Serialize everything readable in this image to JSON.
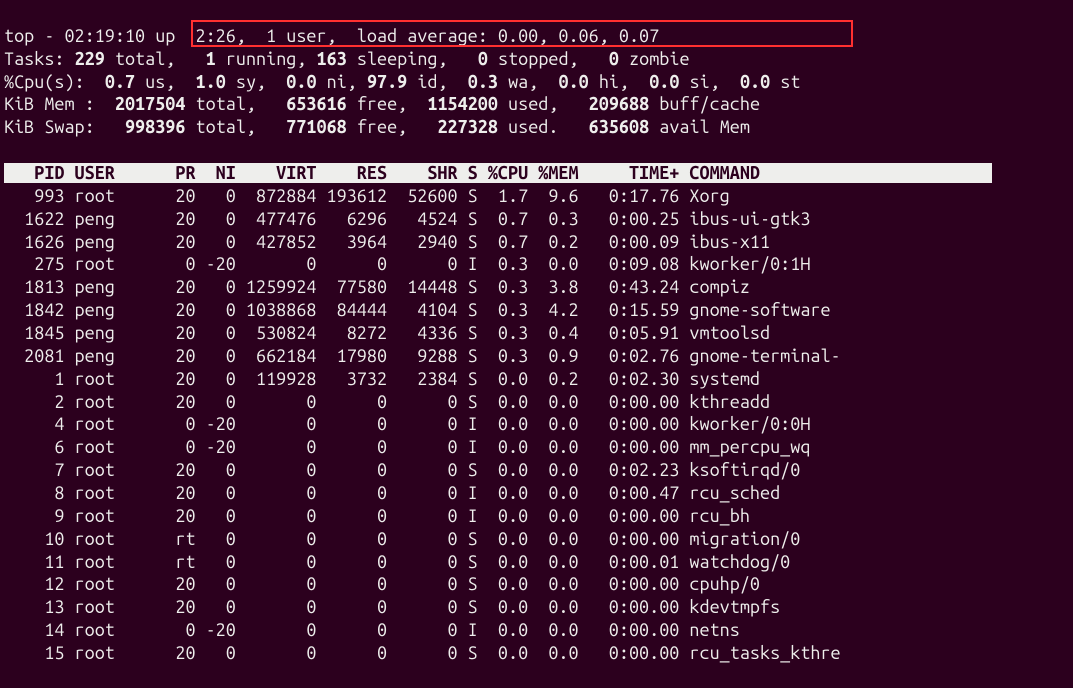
{
  "summary": {
    "l1a": "top - 02:19:10 up  2:26,  1 user,  load average: 0.00, 0.06, 0.07",
    "l1b": "",
    "l2a": "Tasks: ",
    "l2b": "229 ",
    "l2c": "total,   ",
    "l2d": "1 ",
    "l2e": "running, ",
    "l2f": "163 ",
    "l2g": "sleeping,   ",
    "l2h": "0 ",
    "l2i": "stopped,   ",
    "l2j": "0 ",
    "l2k": "zombie",
    "l3a": "%Cpu(s):  ",
    "l3b": "0.7 ",
    "l3c": "us,  ",
    "l3d": "1.0 ",
    "l3e": "sy,  ",
    "l3f": "0.0 ",
    "l3g": "ni, ",
    "l3h": "97.9 ",
    "l3i": "id,  ",
    "l3j": "0.3 ",
    "l3k": "wa,  ",
    "l3l": "0.0 ",
    "l3m": "hi,  ",
    "l3n": "0.0 ",
    "l3o": "si,  ",
    "l3p": "0.0 ",
    "l3q": "st",
    "l4a": "KiB Mem :  ",
    "l4b": "2017504 ",
    "l4c": "total,   ",
    "l4d": "653616 ",
    "l4e": "free,  ",
    "l4f": "1154200 ",
    "l4g": "used,   ",
    "l4h": "209688 ",
    "l4i": "buff/cache",
    "l5a": "KiB Swap:   ",
    "l5b": "998396 ",
    "l5c": "total,   ",
    "l5d": "771068 ",
    "l5e": "free,   ",
    "l5f": "227328 ",
    "l5g": "used.   ",
    "l5h": "635608 ",
    "l5i": "avail Mem "
  },
  "columns": [
    "PID",
    "USER",
    "PR",
    "NI",
    "VIRT",
    "RES",
    "SHR",
    "S",
    "%CPU",
    "%MEM",
    "TIME+",
    "COMMAND"
  ],
  "header": "   PID USER      PR  NI    VIRT    RES    SHR S %CPU %MEM     TIME+ COMMAND                       ",
  "processes": [
    {
      "pid": 993,
      "user": "root",
      "pr": "20",
      "ni": "0",
      "virt": "872884",
      "res": "193612",
      "shr": "52600",
      "s": "S",
      "cpu": "1.7",
      "mem": "9.6",
      "time": "0:17.76",
      "command": "Xorg"
    },
    {
      "pid": 1622,
      "user": "peng",
      "pr": "20",
      "ni": "0",
      "virt": "477476",
      "res": "6296",
      "shr": "4524",
      "s": "S",
      "cpu": "0.7",
      "mem": "0.3",
      "time": "0:00.25",
      "command": "ibus-ui-gtk3"
    },
    {
      "pid": 1626,
      "user": "peng",
      "pr": "20",
      "ni": "0",
      "virt": "427852",
      "res": "3964",
      "shr": "2940",
      "s": "S",
      "cpu": "0.7",
      "mem": "0.2",
      "time": "0:00.09",
      "command": "ibus-x11"
    },
    {
      "pid": 275,
      "user": "root",
      "pr": "0",
      "ni": "-20",
      "virt": "0",
      "res": "0",
      "shr": "0",
      "s": "I",
      "cpu": "0.3",
      "mem": "0.0",
      "time": "0:09.08",
      "command": "kworker/0:1H"
    },
    {
      "pid": 1813,
      "user": "peng",
      "pr": "20",
      "ni": "0",
      "virt": "1259924",
      "res": "77580",
      "shr": "14448",
      "s": "S",
      "cpu": "0.3",
      "mem": "3.8",
      "time": "0:43.24",
      "command": "compiz"
    },
    {
      "pid": 1842,
      "user": "peng",
      "pr": "20",
      "ni": "0",
      "virt": "1038868",
      "res": "84444",
      "shr": "4104",
      "s": "S",
      "cpu": "0.3",
      "mem": "4.2",
      "time": "0:15.59",
      "command": "gnome-software"
    },
    {
      "pid": 1845,
      "user": "peng",
      "pr": "20",
      "ni": "0",
      "virt": "530824",
      "res": "8272",
      "shr": "4336",
      "s": "S",
      "cpu": "0.3",
      "mem": "0.4",
      "time": "0:05.91",
      "command": "vmtoolsd"
    },
    {
      "pid": 2081,
      "user": "peng",
      "pr": "20",
      "ni": "0",
      "virt": "662184",
      "res": "17980",
      "shr": "9288",
      "s": "S",
      "cpu": "0.3",
      "mem": "0.9",
      "time": "0:02.76",
      "command": "gnome-terminal-"
    },
    {
      "pid": 1,
      "user": "root",
      "pr": "20",
      "ni": "0",
      "virt": "119928",
      "res": "3732",
      "shr": "2384",
      "s": "S",
      "cpu": "0.0",
      "mem": "0.2",
      "time": "0:02.30",
      "command": "systemd"
    },
    {
      "pid": 2,
      "user": "root",
      "pr": "20",
      "ni": "0",
      "virt": "0",
      "res": "0",
      "shr": "0",
      "s": "S",
      "cpu": "0.0",
      "mem": "0.0",
      "time": "0:00.00",
      "command": "kthreadd"
    },
    {
      "pid": 4,
      "user": "root",
      "pr": "0",
      "ni": "-20",
      "virt": "0",
      "res": "0",
      "shr": "0",
      "s": "I",
      "cpu": "0.0",
      "mem": "0.0",
      "time": "0:00.00",
      "command": "kworker/0:0H"
    },
    {
      "pid": 6,
      "user": "root",
      "pr": "0",
      "ni": "-20",
      "virt": "0",
      "res": "0",
      "shr": "0",
      "s": "I",
      "cpu": "0.0",
      "mem": "0.0",
      "time": "0:00.00",
      "command": "mm_percpu_wq"
    },
    {
      "pid": 7,
      "user": "root",
      "pr": "20",
      "ni": "0",
      "virt": "0",
      "res": "0",
      "shr": "0",
      "s": "S",
      "cpu": "0.0",
      "mem": "0.0",
      "time": "0:02.23",
      "command": "ksoftirqd/0"
    },
    {
      "pid": 8,
      "user": "root",
      "pr": "20",
      "ni": "0",
      "virt": "0",
      "res": "0",
      "shr": "0",
      "s": "I",
      "cpu": "0.0",
      "mem": "0.0",
      "time": "0:00.47",
      "command": "rcu_sched"
    },
    {
      "pid": 9,
      "user": "root",
      "pr": "20",
      "ni": "0",
      "virt": "0",
      "res": "0",
      "shr": "0",
      "s": "I",
      "cpu": "0.0",
      "mem": "0.0",
      "time": "0:00.00",
      "command": "rcu_bh"
    },
    {
      "pid": 10,
      "user": "root",
      "pr": "rt",
      "ni": "0",
      "virt": "0",
      "res": "0",
      "shr": "0",
      "s": "S",
      "cpu": "0.0",
      "mem": "0.0",
      "time": "0:00.00",
      "command": "migration/0"
    },
    {
      "pid": 11,
      "user": "root",
      "pr": "rt",
      "ni": "0",
      "virt": "0",
      "res": "0",
      "shr": "0",
      "s": "S",
      "cpu": "0.0",
      "mem": "0.0",
      "time": "0:00.01",
      "command": "watchdog/0"
    },
    {
      "pid": 12,
      "user": "root",
      "pr": "20",
      "ni": "0",
      "virt": "0",
      "res": "0",
      "shr": "0",
      "s": "S",
      "cpu": "0.0",
      "mem": "0.0",
      "time": "0:00.00",
      "command": "cpuhp/0"
    },
    {
      "pid": 13,
      "user": "root",
      "pr": "20",
      "ni": "0",
      "virt": "0",
      "res": "0",
      "shr": "0",
      "s": "S",
      "cpu": "0.0",
      "mem": "0.0",
      "time": "0:00.00",
      "command": "kdevtmpfs"
    },
    {
      "pid": 14,
      "user": "root",
      "pr": "0",
      "ni": "-20",
      "virt": "0",
      "res": "0",
      "shr": "0",
      "s": "I",
      "cpu": "0.0",
      "mem": "0.0",
      "time": "0:00.00",
      "command": "netns"
    },
    {
      "pid": 15,
      "user": "root",
      "pr": "20",
      "ni": "0",
      "virt": "0",
      "res": "0",
      "shr": "0",
      "s": "S",
      "cpu": "0.0",
      "mem": "0.0",
      "time": "0:00.00",
      "command": "rcu_tasks_kthre"
    }
  ],
  "rows": []
}
